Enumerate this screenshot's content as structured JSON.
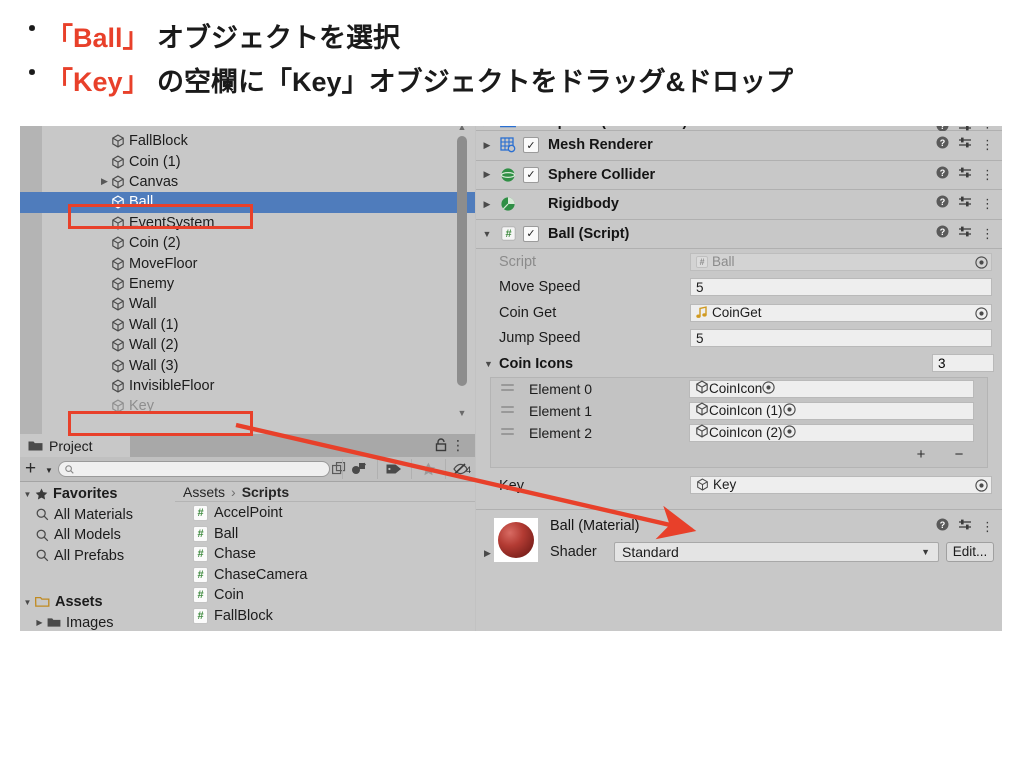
{
  "slide": {
    "bullets": [
      {
        "marker": "・",
        "pre": "",
        "highlight": "「Ball」",
        "post": " オブジェクトを選択"
      },
      {
        "marker": "・",
        "pre": "",
        "highlight": "「Key」",
        "post": " の空欄に「Key」オブジェクトをドラッグ&ドロップ"
      }
    ],
    "accent_color": "#e8402a"
  },
  "hierarchy": {
    "rows": [
      {
        "label": "FallBlock",
        "expandable": false,
        "selected": false,
        "dim": false
      },
      {
        "label": "Coin (1)",
        "expandable": false,
        "selected": false,
        "dim": false
      },
      {
        "label": "Canvas",
        "expandable": true,
        "selected": false,
        "dim": false
      },
      {
        "label": "Ball",
        "expandable": false,
        "selected": true,
        "dim": false
      },
      {
        "label": "EventSystem",
        "expandable": false,
        "selected": false,
        "dim": false
      },
      {
        "label": "Coin (2)",
        "expandable": false,
        "selected": false,
        "dim": false
      },
      {
        "label": "MoveFloor",
        "expandable": false,
        "selected": false,
        "dim": false
      },
      {
        "label": "Enemy",
        "expandable": false,
        "selected": false,
        "dim": false
      },
      {
        "label": "Wall",
        "expandable": false,
        "selected": false,
        "dim": false
      },
      {
        "label": "Wall (1)",
        "expandable": false,
        "selected": false,
        "dim": false
      },
      {
        "label": "Wall (2)",
        "expandable": false,
        "selected": false,
        "dim": false
      },
      {
        "label": "Wall (3)",
        "expandable": false,
        "selected": false,
        "dim": false
      },
      {
        "label": "InvisibleFloor",
        "expandable": false,
        "selected": false,
        "dim": false
      },
      {
        "label": "Key",
        "expandable": false,
        "selected": false,
        "dim": true
      }
    ],
    "selection_color": "#4f7cbc"
  },
  "project": {
    "tab_label": "Project",
    "search_placeholder": "",
    "hidden_count": "4",
    "favorites": {
      "label": "Favorites",
      "items": [
        "All Materials",
        "All Models",
        "All Prefabs"
      ]
    },
    "assets": {
      "label": "Assets",
      "items": [
        "Images"
      ]
    },
    "breadcrumb": {
      "root": "Assets",
      "current": "Scripts"
    },
    "files": [
      "AccelPoint",
      "Ball",
      "Chase",
      "ChaseCamera",
      "Coin",
      "FallBlock"
    ]
  },
  "inspector": {
    "components": [
      {
        "title": "Sphere (Mesh Filter)",
        "has_checkbox": false,
        "checked": false,
        "expanded": false,
        "icon": "mesh-filter-icon",
        "clipped": true
      },
      {
        "title": "Mesh Renderer",
        "has_checkbox": true,
        "checked": true,
        "expanded": false,
        "icon": "mesh-renderer-icon",
        "clipped": false
      },
      {
        "title": "Sphere Collider",
        "has_checkbox": true,
        "checked": true,
        "expanded": false,
        "icon": "sphere-collider-icon",
        "clipped": false
      },
      {
        "title": "Rigidbody",
        "has_checkbox": false,
        "checked": false,
        "expanded": false,
        "icon": "rigidbody-icon",
        "clipped": false
      },
      {
        "title": "Ball (Script)",
        "has_checkbox": true,
        "checked": true,
        "expanded": true,
        "icon": "script-icon",
        "clipped": false
      }
    ],
    "checkmark": "✓",
    "script_fields": [
      {
        "label": "Script",
        "value": "Ball",
        "readonly": true,
        "icon": "script-icon",
        "object_picker": true
      },
      {
        "label": "Move Speed",
        "value": "5",
        "readonly": false,
        "icon": "",
        "object_picker": false
      },
      {
        "label": "Coin Get",
        "value": "CoinGet",
        "readonly": false,
        "icon": "audio-icon",
        "object_picker": true
      },
      {
        "label": "Jump Speed",
        "value": "5",
        "readonly": false,
        "icon": "",
        "object_picker": false
      }
    ],
    "array": {
      "label": "Coin Icons",
      "size": "3",
      "elements": [
        {
          "label": "Element 0",
          "value": "CoinIcon"
        },
        {
          "label": "Element 1",
          "value": "CoinIcon (1)"
        },
        {
          "label": "Element 2",
          "value": "CoinIcon (2)"
        }
      ],
      "add_label": "+",
      "remove_label": "−"
    },
    "key_field": {
      "label": "Key",
      "value": "Key",
      "icon": "gameobject-icon"
    },
    "material": {
      "title": "Ball (Material)",
      "shader_label": "Shader",
      "shader_value": "Standard",
      "edit_label": "Edit...",
      "preview_color": "#b33b33"
    },
    "icons": {
      "help": "?",
      "preset": "preset-icon",
      "menu": "⋮"
    }
  }
}
